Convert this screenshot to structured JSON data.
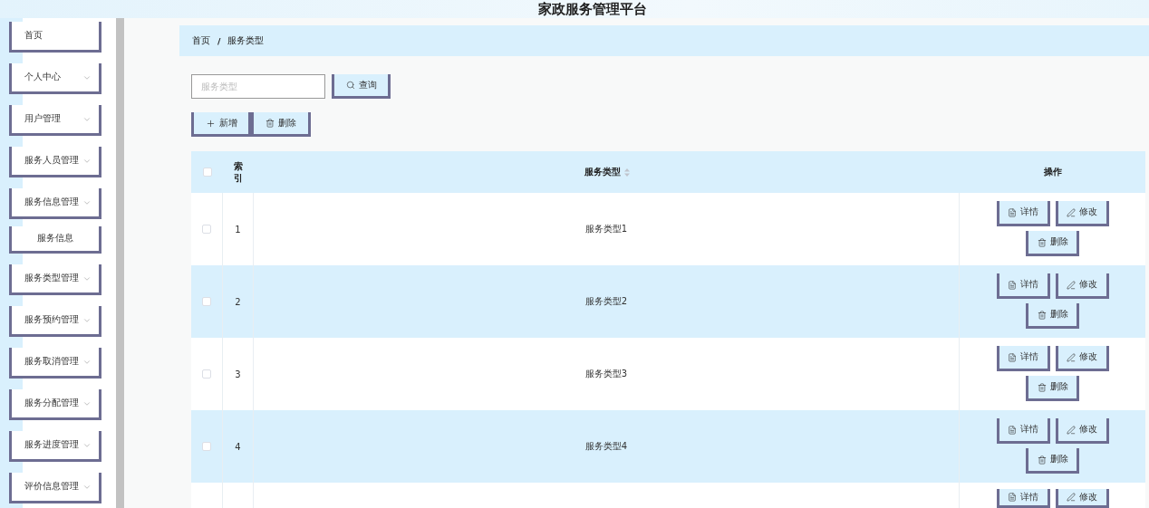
{
  "header": {
    "title": "家政服务管理平台"
  },
  "sidebar": {
    "items": [
      {
        "kind": "link",
        "label": "首页"
      },
      {
        "kind": "submenu",
        "label": "个人中心"
      },
      {
        "kind": "submenu",
        "label": "用户管理"
      },
      {
        "kind": "submenu",
        "label": "服务人员管理"
      },
      {
        "kind": "submenu",
        "label": "服务信息管理",
        "children": [
          {
            "label": "服务信息"
          }
        ]
      },
      {
        "kind": "submenu",
        "label": "服务类型管理"
      },
      {
        "kind": "submenu",
        "label": "服务预约管理"
      },
      {
        "kind": "submenu",
        "label": "服务取消管理"
      },
      {
        "kind": "submenu",
        "label": "服务分配管理"
      },
      {
        "kind": "submenu",
        "label": "服务进度管理"
      },
      {
        "kind": "submenu",
        "label": "评价信息管理"
      }
    ]
  },
  "breadcrumb": {
    "items": [
      "首页",
      "服务类型"
    ],
    "separator": "/"
  },
  "search": {
    "placeholder": "服务类型",
    "button": "查询"
  },
  "toolbar": [
    {
      "kind": "add",
      "label": "新增"
    },
    {
      "kind": "delete",
      "label": "删除"
    }
  ],
  "table": {
    "select_all": {
      "checked": false
    },
    "columns": [
      {
        "label": "索引"
      },
      {
        "label": "服务类型",
        "sortable": true
      },
      {
        "label": "操作"
      }
    ],
    "rows": [
      {
        "checked": false,
        "index": "1",
        "name": "服务类型1",
        "actions": [
          {
            "kind": "detail",
            "label": "详情"
          },
          {
            "kind": "edit",
            "label": "修改"
          },
          {
            "kind": "delete",
            "label": "删除"
          }
        ]
      },
      {
        "checked": false,
        "index": "2",
        "name": "服务类型2",
        "actions": [
          {
            "kind": "detail",
            "label": "详情"
          },
          {
            "kind": "edit",
            "label": "修改"
          },
          {
            "kind": "delete",
            "label": "删除"
          }
        ]
      },
      {
        "checked": false,
        "index": "3",
        "name": "服务类型3",
        "actions": [
          {
            "kind": "detail",
            "label": "详情"
          },
          {
            "kind": "edit",
            "label": "修改"
          },
          {
            "kind": "delete",
            "label": "删除"
          }
        ]
      },
      {
        "checked": false,
        "index": "4",
        "name": "服务类型4",
        "actions": [
          {
            "kind": "detail",
            "label": "详情"
          },
          {
            "kind": "edit",
            "label": "修改"
          },
          {
            "kind": "delete",
            "label": "删除"
          }
        ]
      },
      {
        "actions": [
          {
            "kind": "detail",
            "label": "详情"
          },
          {
            "kind": "edit",
            "label": "修改"
          }
        ]
      }
    ]
  }
}
